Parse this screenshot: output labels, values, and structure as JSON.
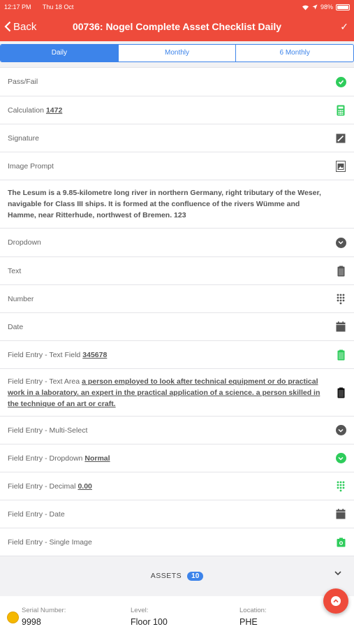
{
  "status_bar": {
    "time": "12:17 PM",
    "date": "Thu 18 Oct",
    "battery": "98%"
  },
  "nav": {
    "back_label": "Back",
    "title": "00736: Nogel Complete Asset Checklist Daily"
  },
  "tabs": [
    {
      "label": "Daily"
    },
    {
      "label": "Monthly"
    },
    {
      "label": "6 Monthly"
    }
  ],
  "rows": [
    {
      "label": "Pass/Fail",
      "value": "",
      "icon": "check-circle-icon"
    },
    {
      "label": "Calculation",
      "value": "1472",
      "icon": "calculator-icon"
    },
    {
      "label": "Signature",
      "value": "",
      "icon": "signature-icon"
    },
    {
      "label": "Image Prompt",
      "value": "",
      "icon": "image-icon"
    },
    {
      "label": "The Lesum is a 9.85-kilometre long river in northern Germany, right tributary of the Weser, navigable for Class III ships. It is formed at the confluence of the rivers Wümme and Hamme, near Ritterhude, northwest of Bremen. 123",
      "value": "",
      "icon": ""
    },
    {
      "label": "Dropdown",
      "value": "",
      "icon": "dropdown-icon"
    },
    {
      "label": "Text",
      "value": "",
      "icon": "clipboard-icon"
    },
    {
      "label": "Number",
      "value": "",
      "icon": "keypad-icon"
    },
    {
      "label": "Date",
      "value": "",
      "icon": "calendar-icon"
    },
    {
      "label": "Field Entry - Text Field",
      "value": "345678",
      "icon": "clipboard-icon"
    },
    {
      "label": "Field Entry - Text Area",
      "value": "a person employed to look after technical equipment or do practical work in a laboratory. an expert in the practical application of a science. a person skilled in the technique of an art or craft.",
      "icon": "clipboard-icon"
    },
    {
      "label": "Field Entry - Multi-Select",
      "value": "",
      "icon": "dropdown-icon"
    },
    {
      "label": "Field Entry - Dropdown",
      "value": "Normal",
      "icon": "dropdown-icon"
    },
    {
      "label": "Field Entry - Decimal",
      "value": "0.00",
      "icon": "keypad-icon"
    },
    {
      "label": "Field Entry - Date",
      "value": "",
      "icon": "calendar-icon"
    },
    {
      "label": "Field Entry - Single Image",
      "value": "",
      "icon": "camera-icon"
    }
  ],
  "assets": {
    "label": "ASSETS",
    "count": "10"
  },
  "footer": {
    "serial_label": "Serial Number:",
    "serial_value": "9998",
    "level_label": "Level:",
    "level_value": "Floor 100",
    "location_label": "Location:",
    "location_value": "PHE"
  },
  "colors": {
    "brand_red": "#ee4b3b",
    "accent_blue": "#3d84ea",
    "done_green": "#2ecc5b",
    "icon_grey": "#555555",
    "status_yellow": "#f5b800"
  }
}
